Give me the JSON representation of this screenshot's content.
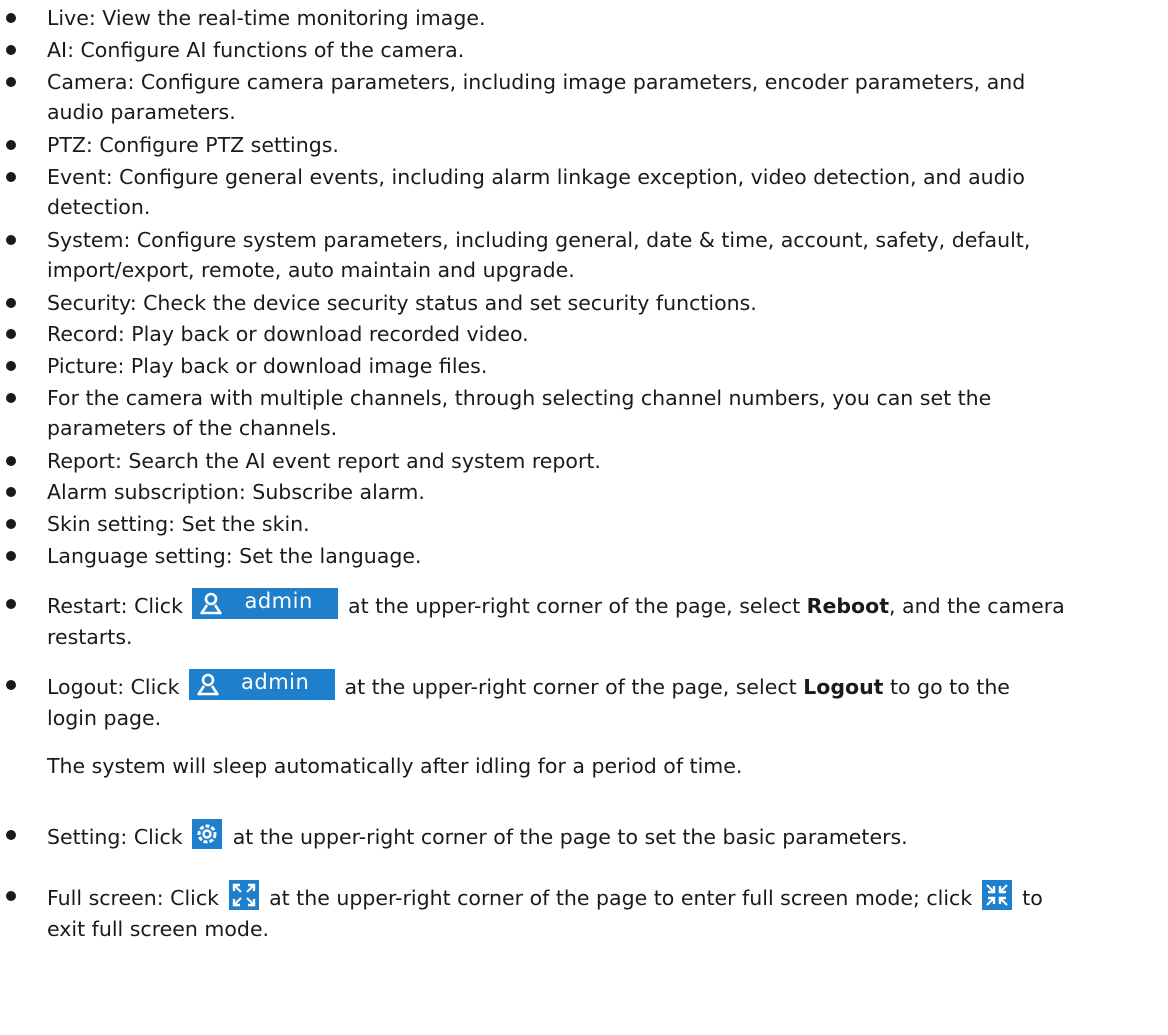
{
  "items": [
    {
      "text": "Live: View the real-time monitoring image."
    },
    {
      "text": "AI: Configure AI functions of the camera."
    },
    {
      "line1": "Camera: Configure camera parameters, including image parameters, encoder parameters, and",
      "line2": "audio parameters."
    },
    {
      "text": "PTZ: Configure PTZ settings."
    },
    {
      "line1": "Event: Configure general events, including alarm linkage exception, video detection, and audio",
      "line2": "detection."
    },
    {
      "line1": "System: Configure system parameters, including general, date & time, account, safety, default,",
      "line2": "import/export, remote, auto maintain and upgrade."
    },
    {
      "text": "Security: Check the device security status and set security functions."
    },
    {
      "text": "Record: Play back or download recorded video."
    },
    {
      "text": "Picture: Play back or download image files."
    },
    {
      "line1": "For the camera with multiple channels, through selecting channel numbers, you can set the",
      "line2": "parameters of the channels."
    },
    {
      "text": "Report: Search the AI event report and system report."
    },
    {
      "text": "Alarm subscription: Subscribe alarm."
    },
    {
      "text": "Skin setting: Set the skin."
    },
    {
      "text": "Language setting: Set the language."
    }
  ],
  "restart": {
    "prefix": "Restart: Click",
    "button_label": "admin",
    "middle": "at the upper-right corner of the page, select",
    "bold": "Reboot",
    "suffix": ", and the camera",
    "line2": "restarts."
  },
  "logout": {
    "prefix": "Logout: Click",
    "button_label": "admin",
    "middle": "at the upper-right corner of the page, select",
    "bold": "Logout",
    "suffix": " to go to the",
    "line2": "login page."
  },
  "sleep_note": "The system will sleep automatically after idling for a period of time.",
  "setting": {
    "prefix": "Setting: Click",
    "icon": "gear-icon",
    "suffix": "at the upper-right corner of the page to set the basic parameters."
  },
  "fullscreen": {
    "prefix": "Full screen: Click",
    "icon_enter": "expand-icon",
    "middle": "at the upper-right corner of the page to enter full screen mode; click",
    "icon_exit": "collapse-icon",
    "suffix": "to",
    "line2": "exit full screen mode."
  },
  "colors": {
    "accent": "#1e7fcd",
    "text": "#1a1a1a"
  }
}
